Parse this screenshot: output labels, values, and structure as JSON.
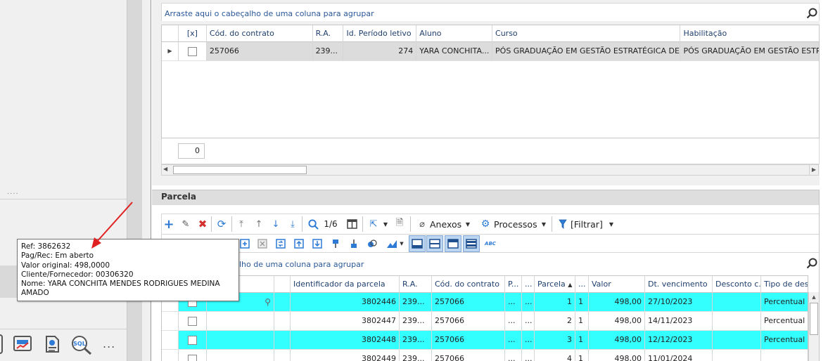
{
  "top_grid": {
    "group_hint": "Arraste aqui o cabeçalho de uma coluna para agrupar",
    "columns": [
      "[x]",
      "Cód. do contrato",
      "R.A.",
      "Id. Período letivo",
      "Aluno",
      "Curso",
      "Habilitação"
    ],
    "rows": [
      {
        "cod_contrato": "257066",
        "ra": "239...",
        "periodo": "274",
        "aluno": "YARA CONCHITA...",
        "curso": "PÓS GRADUAÇÃO EM GESTÃO ESTRATÉGICA DE N...",
        "habilitacao": "PÓS GRADUAÇÃO EM GESTÃO ESTRAT"
      }
    ],
    "count": "0"
  },
  "section": {
    "title": "Parcela",
    "group_hint": "lho de uma coluna para agrupar"
  },
  "toolbar": {
    "record_position": "1/6",
    "anexos_label": "Anexos",
    "processos_label": "Processos",
    "filtrar_label": "[Filtrar]",
    "abc_label": "ABC"
  },
  "bottom_grid": {
    "columns": [
      "Identificador da parcela",
      "R.A.",
      "Cód. do contrato",
      "P...",
      "...",
      "Parcela",
      "...",
      "Valor",
      "Dt. vencimento",
      "Desconto c...",
      "Tipo de desconto"
    ],
    "rows": [
      {
        "id": "3802446",
        "ra": "239...",
        "contrato": "257066",
        "p": "...",
        "x": "...",
        "parcela": "1",
        "y": "1",
        "valor": "498,00",
        "venc": "27/10/2023",
        "desc": "",
        "tipo": "Percentual",
        "highlight": true
      },
      {
        "id": "3802447",
        "ra": "239...",
        "contrato": "257066",
        "p": "...",
        "x": "...",
        "parcela": "2",
        "y": "1",
        "valor": "498,00",
        "venc": "14/11/2023",
        "desc": "",
        "tipo": "Percentual",
        "highlight": false
      },
      {
        "id": "3802448",
        "ra": "239...",
        "contrato": "257066",
        "p": "...",
        "x": "...",
        "parcela": "3",
        "y": "1",
        "valor": "498,00",
        "venc": "12/12/2023",
        "desc": "",
        "tipo": "Percentual",
        "highlight": true
      },
      {
        "id": "3802449",
        "ra": "239...",
        "contrato": "257066",
        "p": "...",
        "x": "...",
        "parcela": "4",
        "y": "1",
        "valor": "498,00",
        "venc": "11/01/2024",
        "desc": "",
        "tipo": "",
        "highlight": false
      }
    ]
  },
  "tooltip": {
    "ref": "Ref: 3862632",
    "pagrec": "Pag/Rec: Em aberto",
    "valor": "Valor original: 498,0000",
    "cliente": "Cliente/Fornecedor: 00306320",
    "nome": "Nome: YARA CONCHITA MENDES RODRIGUES MEDINA AMADO"
  },
  "left_pane": {
    "dots": "....",
    "more": "..."
  },
  "colors": {
    "highlight_row": "#33ffff",
    "accent_blue": "#2b5797",
    "delete_red": "#d32f2f",
    "arrow_red": "#e02020"
  }
}
